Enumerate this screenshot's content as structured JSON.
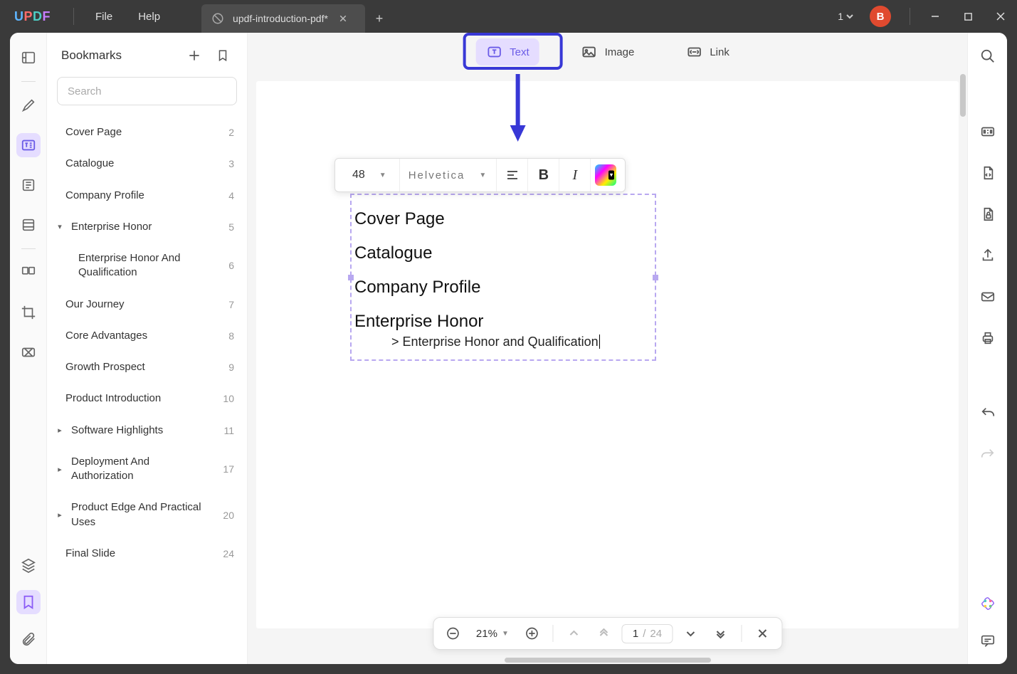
{
  "titlebar": {
    "menu": {
      "file": "File",
      "help": "Help"
    },
    "tab": {
      "title": "updf-introduction-pdf*"
    },
    "badge": "1",
    "avatar_initial": "B"
  },
  "bookmarks": {
    "title": "Bookmarks",
    "search_placeholder": "Search",
    "items": [
      {
        "label": "Cover Page",
        "page": "2",
        "expand": null
      },
      {
        "label": "Catalogue",
        "page": "3",
        "expand": null
      },
      {
        "label": "Company Profile",
        "page": "4",
        "expand": null
      },
      {
        "label": "Enterprise Honor",
        "page": "5",
        "expand": "down"
      },
      {
        "label": "Enterprise Honor And Qualification",
        "page": "6",
        "nested": true
      },
      {
        "label": "Our Journey",
        "page": "7",
        "expand": null
      },
      {
        "label": "Core Advantages",
        "page": "8",
        "expand": null
      },
      {
        "label": "Growth Prospect",
        "page": "9",
        "expand": null
      },
      {
        "label": "Product Introduction",
        "page": "10",
        "expand": null
      },
      {
        "label": "Software Highlights",
        "page": "11",
        "expand": "right"
      },
      {
        "label": "Deployment And Authorization",
        "page": "17",
        "expand": "right"
      },
      {
        "label": "Product Edge And Practical Uses",
        "page": "20",
        "expand": "right"
      },
      {
        "label": "Final Slide",
        "page": "24",
        "expand": null
      }
    ]
  },
  "toolbar": {
    "text": "Text",
    "image": "Image",
    "link": "Link"
  },
  "format_bar": {
    "font_size": "48",
    "font_family": "Helvetica"
  },
  "text_box": {
    "lines": [
      "Cover Page",
      "Catalogue",
      "Company Profile",
      "Enterprise Honor"
    ],
    "subline": "> Enterprise Honor and Qualification"
  },
  "bottom_bar": {
    "zoom": "21%",
    "page_current": "1",
    "page_sep": "/",
    "page_total": "24"
  }
}
